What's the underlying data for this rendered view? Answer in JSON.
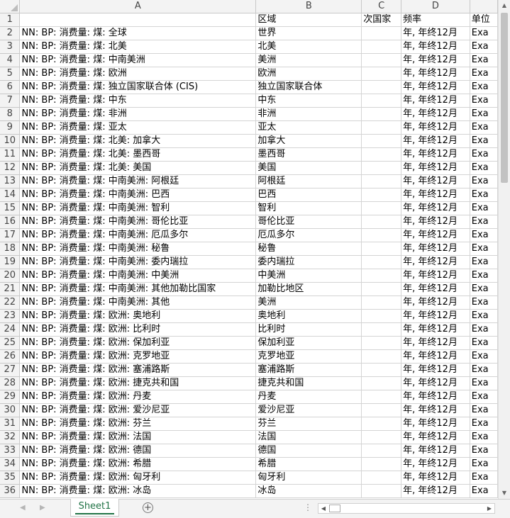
{
  "columns": [
    "A",
    "B",
    "C",
    "D",
    ""
  ],
  "headerRow": {
    "number": "1",
    "cells": [
      "",
      "区域",
      "次国家",
      "频率",
      "单位"
    ]
  },
  "rows": [
    {
      "n": "2",
      "a": "NN: BP: 消费量: 煤: 全球",
      "b": "世界",
      "c": "",
      "d": "年, 年终12月",
      "e": "Exa"
    },
    {
      "n": "3",
      "a": "NN: BP: 消费量: 煤: 北美",
      "b": "北美",
      "c": "",
      "d": "年, 年终12月",
      "e": "Exa"
    },
    {
      "n": "4",
      "a": "NN: BP: 消费量: 煤: 中南美洲",
      "b": "美洲",
      "c": "",
      "d": "年, 年终12月",
      "e": "Exa"
    },
    {
      "n": "5",
      "a": "NN: BP: 消费量: 煤: 欧洲",
      "b": "欧洲",
      "c": "",
      "d": "年, 年终12月",
      "e": "Exa"
    },
    {
      "n": "6",
      "a": "NN: BP: 消费量: 煤: 独立国家联合体 (CIS)",
      "b": "独立国家联合体",
      "c": "",
      "d": "年, 年终12月",
      "e": "Exa"
    },
    {
      "n": "7",
      "a": "NN: BP: 消费量: 煤: 中东",
      "b": "中东",
      "c": "",
      "d": "年, 年终12月",
      "e": "Exa"
    },
    {
      "n": "8",
      "a": "NN: BP: 消费量: 煤: 非洲",
      "b": "非洲",
      "c": "",
      "d": "年, 年终12月",
      "e": "Exa"
    },
    {
      "n": "9",
      "a": "NN: BP: 消费量: 煤: 亚太",
      "b": "亚太",
      "c": "",
      "d": "年, 年终12月",
      "e": "Exa"
    },
    {
      "n": "10",
      "a": "NN: BP: 消费量: 煤: 北美: 加拿大",
      "b": "加拿大",
      "c": "",
      "d": "年, 年终12月",
      "e": "Exa"
    },
    {
      "n": "11",
      "a": "NN: BP: 消费量: 煤: 北美: 墨西哥",
      "b": "墨西哥",
      "c": "",
      "d": "年, 年终12月",
      "e": "Exa"
    },
    {
      "n": "12",
      "a": "NN: BP: 消费量: 煤: 北美: 美国",
      "b": "美国",
      "c": "",
      "d": "年, 年终12月",
      "e": "Exa"
    },
    {
      "n": "13",
      "a": "NN: BP: 消费量: 煤: 中南美洲: 阿根廷",
      "b": "阿根廷",
      "c": "",
      "d": "年, 年终12月",
      "e": "Exa"
    },
    {
      "n": "14",
      "a": "NN: BP: 消费量: 煤: 中南美洲: 巴西",
      "b": "巴西",
      "c": "",
      "d": "年, 年终12月",
      "e": "Exa"
    },
    {
      "n": "15",
      "a": "NN: BP: 消费量: 煤: 中南美洲: 智利",
      "b": "智利",
      "c": "",
      "d": "年, 年终12月",
      "e": "Exa"
    },
    {
      "n": "16",
      "a": "NN: BP: 消费量: 煤: 中南美洲: 哥伦比亚",
      "b": "哥伦比亚",
      "c": "",
      "d": "年, 年终12月",
      "e": "Exa"
    },
    {
      "n": "17",
      "a": "NN: BP: 消费量: 煤: 中南美洲: 厄瓜多尔",
      "b": "厄瓜多尔",
      "c": "",
      "d": "年, 年终12月",
      "e": "Exa"
    },
    {
      "n": "18",
      "a": "NN: BP: 消费量: 煤: 中南美洲: 秘鲁",
      "b": "秘鲁",
      "c": "",
      "d": "年, 年终12月",
      "e": "Exa"
    },
    {
      "n": "19",
      "a": "NN: BP: 消费量: 煤: 中南美洲: 委内瑞拉",
      "b": "委内瑞拉",
      "c": "",
      "d": "年, 年终12月",
      "e": "Exa"
    },
    {
      "n": "20",
      "a": "NN: BP: 消费量: 煤: 中南美洲: 中美洲",
      "b": "中美洲",
      "c": "",
      "d": "年, 年终12月",
      "e": "Exa"
    },
    {
      "n": "21",
      "a": "NN: BP: 消费量: 煤: 中南美洲: 其他加勒比国家",
      "b": "加勒比地区",
      "c": "",
      "d": "年, 年终12月",
      "e": "Exa"
    },
    {
      "n": "22",
      "a": "NN: BP: 消费量: 煤: 中南美洲: 其他",
      "b": "美洲",
      "c": "",
      "d": "年, 年终12月",
      "e": "Exa"
    },
    {
      "n": "23",
      "a": "NN: BP: 消费量: 煤: 欧洲: 奥地利",
      "b": "奥地利",
      "c": "",
      "d": "年, 年终12月",
      "e": "Exa"
    },
    {
      "n": "24",
      "a": "NN: BP: 消费量: 煤: 欧洲: 比利时",
      "b": "比利时",
      "c": "",
      "d": "年, 年终12月",
      "e": "Exa"
    },
    {
      "n": "25",
      "a": "NN: BP: 消费量: 煤: 欧洲: 保加利亚",
      "b": "保加利亚",
      "c": "",
      "d": "年, 年终12月",
      "e": "Exa"
    },
    {
      "n": "26",
      "a": "NN: BP: 消费量: 煤: 欧洲: 克罗地亚",
      "b": "克罗地亚",
      "c": "",
      "d": "年, 年终12月",
      "e": "Exa"
    },
    {
      "n": "27",
      "a": "NN: BP: 消费量: 煤: 欧洲: 塞浦路斯",
      "b": "塞浦路斯",
      "c": "",
      "d": "年, 年终12月",
      "e": "Exa"
    },
    {
      "n": "28",
      "a": "NN: BP: 消费量: 煤: 欧洲: 捷克共和国",
      "b": "捷克共和国",
      "c": "",
      "d": "年, 年终12月",
      "e": "Exa"
    },
    {
      "n": "29",
      "a": "NN: BP: 消费量: 煤: 欧洲: 丹麦",
      "b": "丹麦",
      "c": "",
      "d": "年, 年终12月",
      "e": "Exa"
    },
    {
      "n": "30",
      "a": "NN: BP: 消费量: 煤: 欧洲: 爱沙尼亚",
      "b": "爱沙尼亚",
      "c": "",
      "d": "年, 年终12月",
      "e": "Exa"
    },
    {
      "n": "31",
      "a": "NN: BP: 消费量: 煤: 欧洲: 芬兰",
      "b": "芬兰",
      "c": "",
      "d": "年, 年终12月",
      "e": "Exa"
    },
    {
      "n": "32",
      "a": "NN: BP: 消费量: 煤: 欧洲: 法国",
      "b": "法国",
      "c": "",
      "d": "年, 年终12月",
      "e": "Exa"
    },
    {
      "n": "33",
      "a": "NN: BP: 消费量: 煤: 欧洲: 德国",
      "b": "德国",
      "c": "",
      "d": "年, 年终12月",
      "e": "Exa"
    },
    {
      "n": "34",
      "a": "NN: BP: 消费量: 煤: 欧洲: 希腊",
      "b": "希腊",
      "c": "",
      "d": "年, 年终12月",
      "e": "Exa"
    },
    {
      "n": "35",
      "a": "NN: BP: 消费量: 煤: 欧洲: 匈牙利",
      "b": "匈牙利",
      "c": "",
      "d": "年, 年终12月",
      "e": "Exa"
    },
    {
      "n": "36",
      "a": "NN: BP: 消费量: 煤: 欧洲: 冰岛",
      "b": "冰岛",
      "c": "",
      "d": "年, 年终12月",
      "e": "Exa"
    }
  ],
  "tabs": {
    "sheet1": "Sheet1",
    "add": "+",
    "dots": "⋮"
  },
  "icons": {
    "prevSheet": "◀",
    "nextSheet": "▶",
    "scrollUp": "▲",
    "scrollDown": "▼",
    "scrollLeft": "◀",
    "scrollRight": "▶"
  },
  "colors": {
    "accent": "#217346",
    "headerBg": "#f3f3f3",
    "gridLine": "#d4d4d4"
  }
}
